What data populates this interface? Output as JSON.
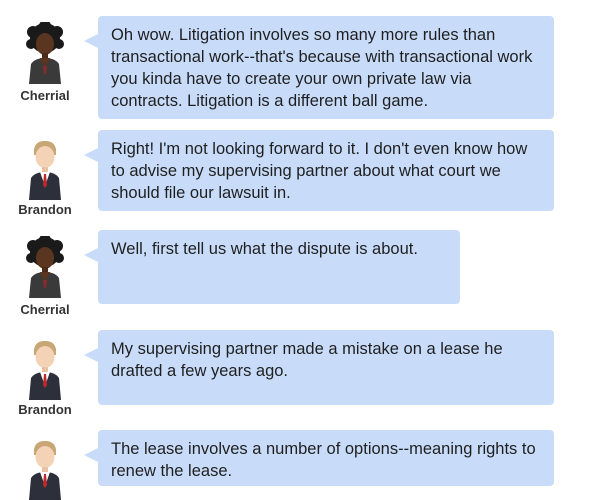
{
  "messages": [
    {
      "speaker": "Cherrial",
      "avatar_icon": "woman-curly-hair-avatar-icon",
      "text": "Oh wow.  Litigation involves so many more rules than transactional work--that's because with transactional work you kinda have to create your own private law via contracts.  Litigation is a different ball game."
    },
    {
      "speaker": "Brandon",
      "avatar_icon": "man-in-suit-avatar-icon",
      "text": "Right!  I'm not looking forward to it.  I don't even know how to advise my supervising partner about what court we should file our lawsuit in."
    },
    {
      "speaker": "Cherrial",
      "avatar_icon": "woman-curly-hair-avatar-icon",
      "text": "Well, first tell us what the dispute is about."
    },
    {
      "speaker": "Brandon",
      "avatar_icon": "man-in-suit-avatar-icon",
      "text": "My supervising partner made a mistake on a lease he drafted a few years ago."
    },
    {
      "speaker": "",
      "avatar_icon": "man-in-suit-avatar-icon",
      "text": "The lease involves a number of options--meaning rights to renew the lease."
    }
  ],
  "colors": {
    "bubble": "#c8dcfa",
    "text": "#1f1f1f",
    "name": "#333333"
  }
}
